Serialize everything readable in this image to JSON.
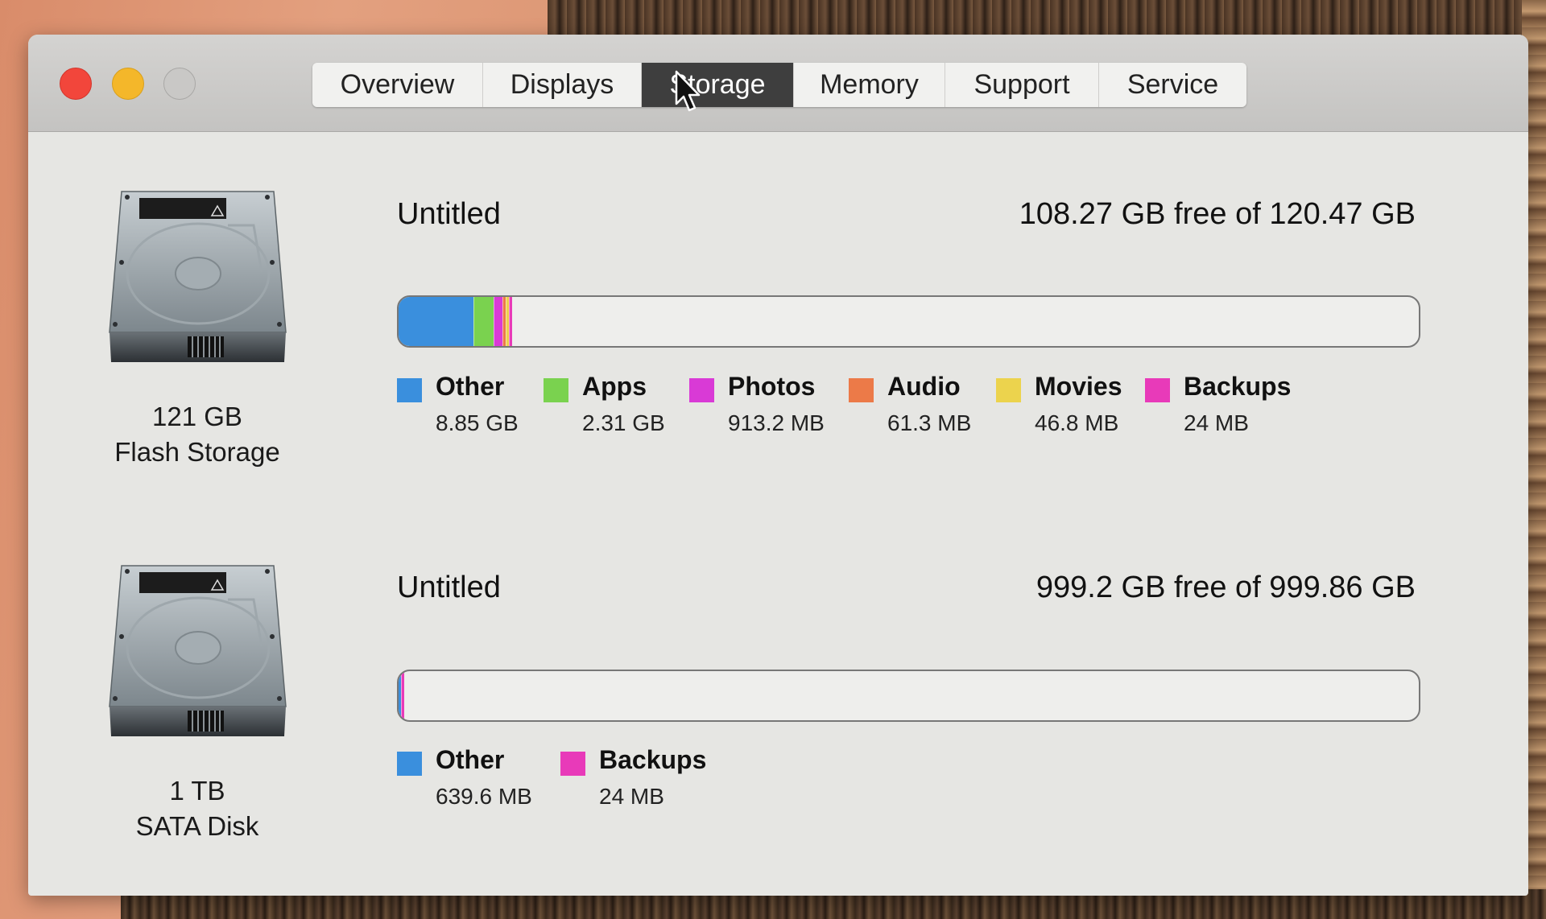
{
  "window": {
    "tabs": [
      {
        "label": "Overview",
        "active": false
      },
      {
        "label": "Displays",
        "active": false
      },
      {
        "label": "Storage",
        "active": true
      },
      {
        "label": "Memory",
        "active": false
      },
      {
        "label": "Support",
        "active": false
      },
      {
        "label": "Service",
        "active": false
      }
    ]
  },
  "colors": {
    "other": "#3a8fdd",
    "apps": "#7ad24f",
    "photos": "#d93ad6",
    "audio": "#ec7a48",
    "movies": "#ecd34d",
    "backups": "#e83ab9"
  },
  "drives": [
    {
      "capacity_label": "121 GB",
      "type_label": "Flash Storage",
      "volume_name": "Untitled",
      "free_text": "108.27 GB free of 120.47 GB",
      "total_gb": 120.47,
      "free_gb": 108.27,
      "categories": [
        {
          "name": "Other",
          "size": "8.85 GB",
          "gb": 8.85,
          "color": "#3a8fdd"
        },
        {
          "name": "Apps",
          "size": "2.31 GB",
          "gb": 2.31,
          "color": "#7ad24f"
        },
        {
          "name": "Photos",
          "size": "913.2 MB",
          "gb": 0.9132,
          "color": "#d93ad6"
        },
        {
          "name": "Audio",
          "size": "61.3 MB",
          "gb": 0.0613,
          "color": "#ec7a48"
        },
        {
          "name": "Movies",
          "size": "46.8 MB",
          "gb": 0.0468,
          "color": "#ecd34d"
        },
        {
          "name": "Backups",
          "size": "24 MB",
          "gb": 0.024,
          "color": "#e83ab9"
        }
      ]
    },
    {
      "capacity_label": "1 TB",
      "type_label": "SATA Disk",
      "volume_name": "Untitled",
      "free_text": "999.2 GB free of 999.86 GB",
      "total_gb": 999.86,
      "free_gb": 999.2,
      "categories": [
        {
          "name": "Other",
          "size": "639.6 MB",
          "gb": 0.6396,
          "color": "#3a8fdd"
        },
        {
          "name": "Backups",
          "size": "24 MB",
          "gb": 0.024,
          "color": "#e83ab9"
        }
      ]
    }
  ]
}
